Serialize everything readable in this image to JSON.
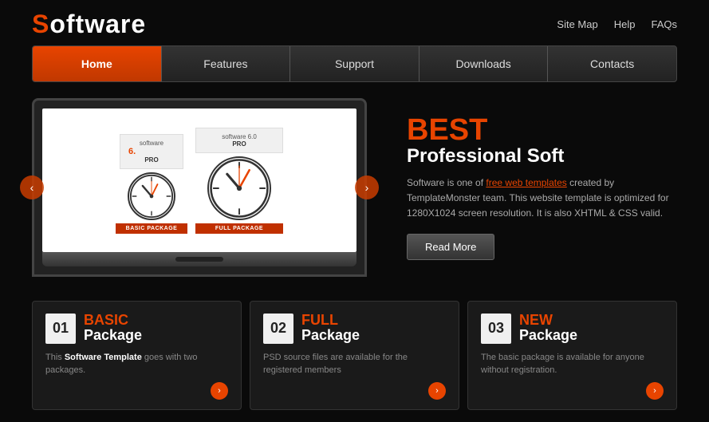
{
  "header": {
    "logo": {
      "s": "S",
      "rest": "oftware"
    },
    "links": [
      {
        "label": "Site Map",
        "id": "site-map"
      },
      {
        "label": "Help",
        "id": "help"
      },
      {
        "label": "FAQs",
        "id": "faqs"
      }
    ]
  },
  "nav": {
    "items": [
      {
        "label": "Home",
        "active": true
      },
      {
        "label": "Features",
        "active": false
      },
      {
        "label": "Support",
        "active": false
      },
      {
        "label": "Downloads",
        "active": false
      },
      {
        "label": "Contacts",
        "active": false
      }
    ]
  },
  "hero": {
    "title": "BEST",
    "subtitle": "Professional Soft",
    "desc_parts": [
      "Software is one of ",
      "free web templates",
      " created by TemplateMonster team. This website template is optimized for 1280X1024 screen resolution. It is also XHTML & CSS valid."
    ],
    "read_more": "Read More"
  },
  "products": {
    "small": {
      "label": "software",
      "version": "6.",
      "type": "PRO",
      "base_label": "BASIC PACKAGE"
    },
    "large": {
      "label": "software 6.0",
      "type": "PRO",
      "base_label": "FULL PACKAGE"
    }
  },
  "packages": [
    {
      "num": "01",
      "name": "BASIC",
      "type": "Package",
      "desc": "This Software Template goes with two packages.",
      "desc_highlights": [
        "Software Template"
      ]
    },
    {
      "num": "02",
      "name": "FULL",
      "type": "Package",
      "desc": "PSD source files are available for the registered members",
      "desc_highlights": []
    },
    {
      "num": "03",
      "name": "NEW",
      "type": "Package",
      "desc": "The basic package is available for anyone without registration.",
      "desc_highlights": []
    }
  ],
  "arrows": {
    "left": "‹",
    "right": "›"
  }
}
